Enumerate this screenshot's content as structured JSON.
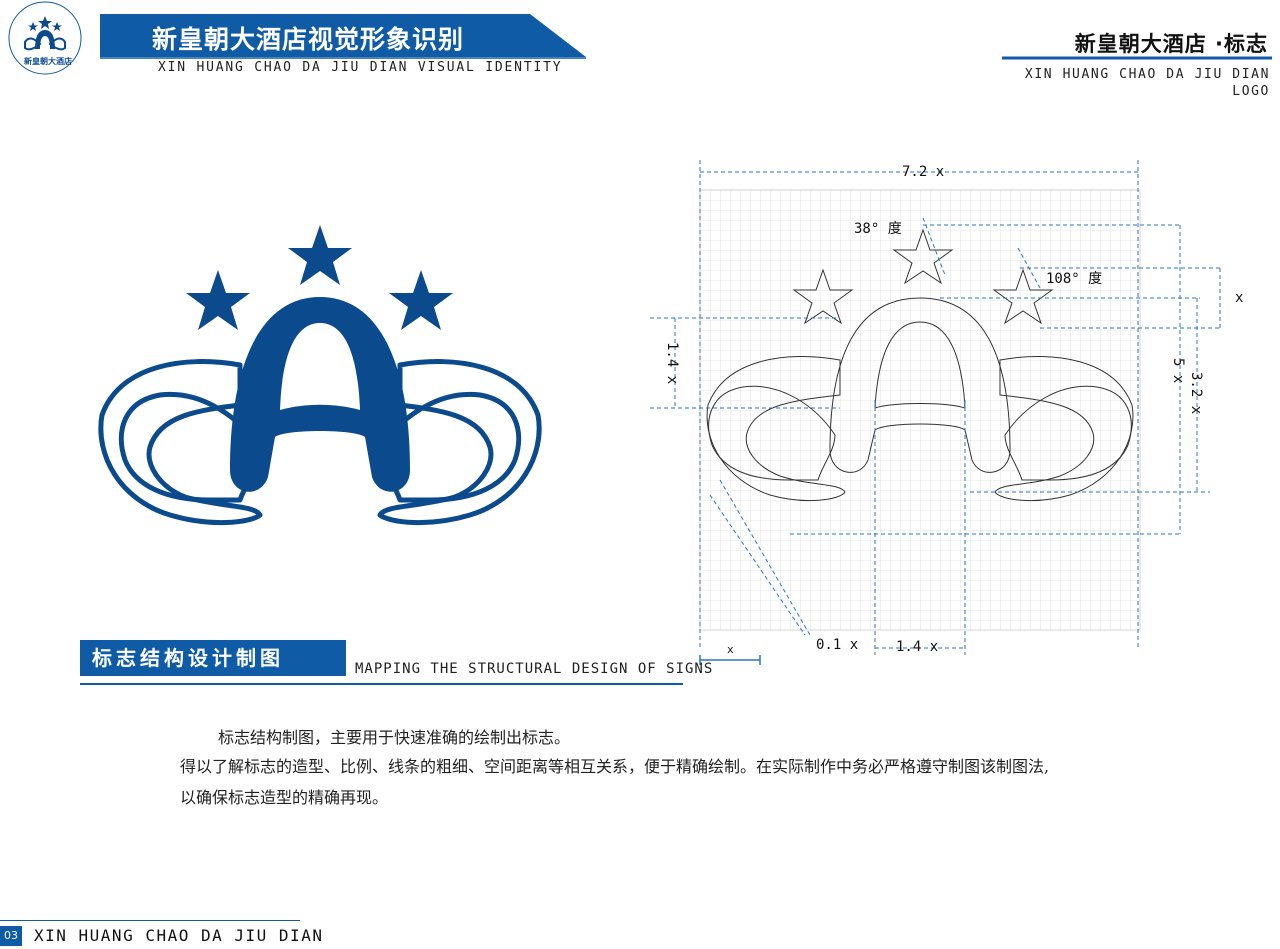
{
  "header": {
    "emblem_text": "XIN HUANG CHAO DA JIU DIAN",
    "emblem_cn": "新皇朝大酒店",
    "title": "新皇朝大酒店视觉形象识别",
    "subtitle": "XIN HUANG CHAO DA JIU DIAN VISUAL IDENTITY",
    "right_title": "新皇朝大酒店 ·标志",
    "right_sub_line1": "XIN HUANG CHAO DA JIU DIAN",
    "right_sub_line2": "LOGO"
  },
  "colors": {
    "brand_blue": "#0f5ba5",
    "logo_blue": "#0b4a8c",
    "dimension_blue": "#2a74c9",
    "grid": "#c9c9c9"
  },
  "diagram": {
    "width_label": "7.2 x",
    "star_angle_label": "38° 度",
    "star_inner_angle_label": "108° 度",
    "right_x_label": "x",
    "left_height_label": "1.4 x",
    "right_5x_label": "5 x",
    "right_32x_label": "3.2 x",
    "stroke_label": "0.1 x",
    "bottom_14x_label": "1.4 x",
    "unit_label": "x"
  },
  "section": {
    "label": "标志结构设计制图",
    "subtitle": "MAPPING THE STRUCTURAL DESIGN OF SIGNS"
  },
  "description": {
    "line1": "标志结构制图，主要用于快速准确的绘制出标志。",
    "line2": "得以了解标志的造型、比例、线条的粗细、空间距离等相互关系，便于精确绘制。在实际制作中务必严格遵守制图该制图法,",
    "line3": "以确保标志造型的精确再现。"
  },
  "footer": {
    "page_number": "03",
    "text": "XIN HUANG CHAO DA JIU DIAN"
  }
}
